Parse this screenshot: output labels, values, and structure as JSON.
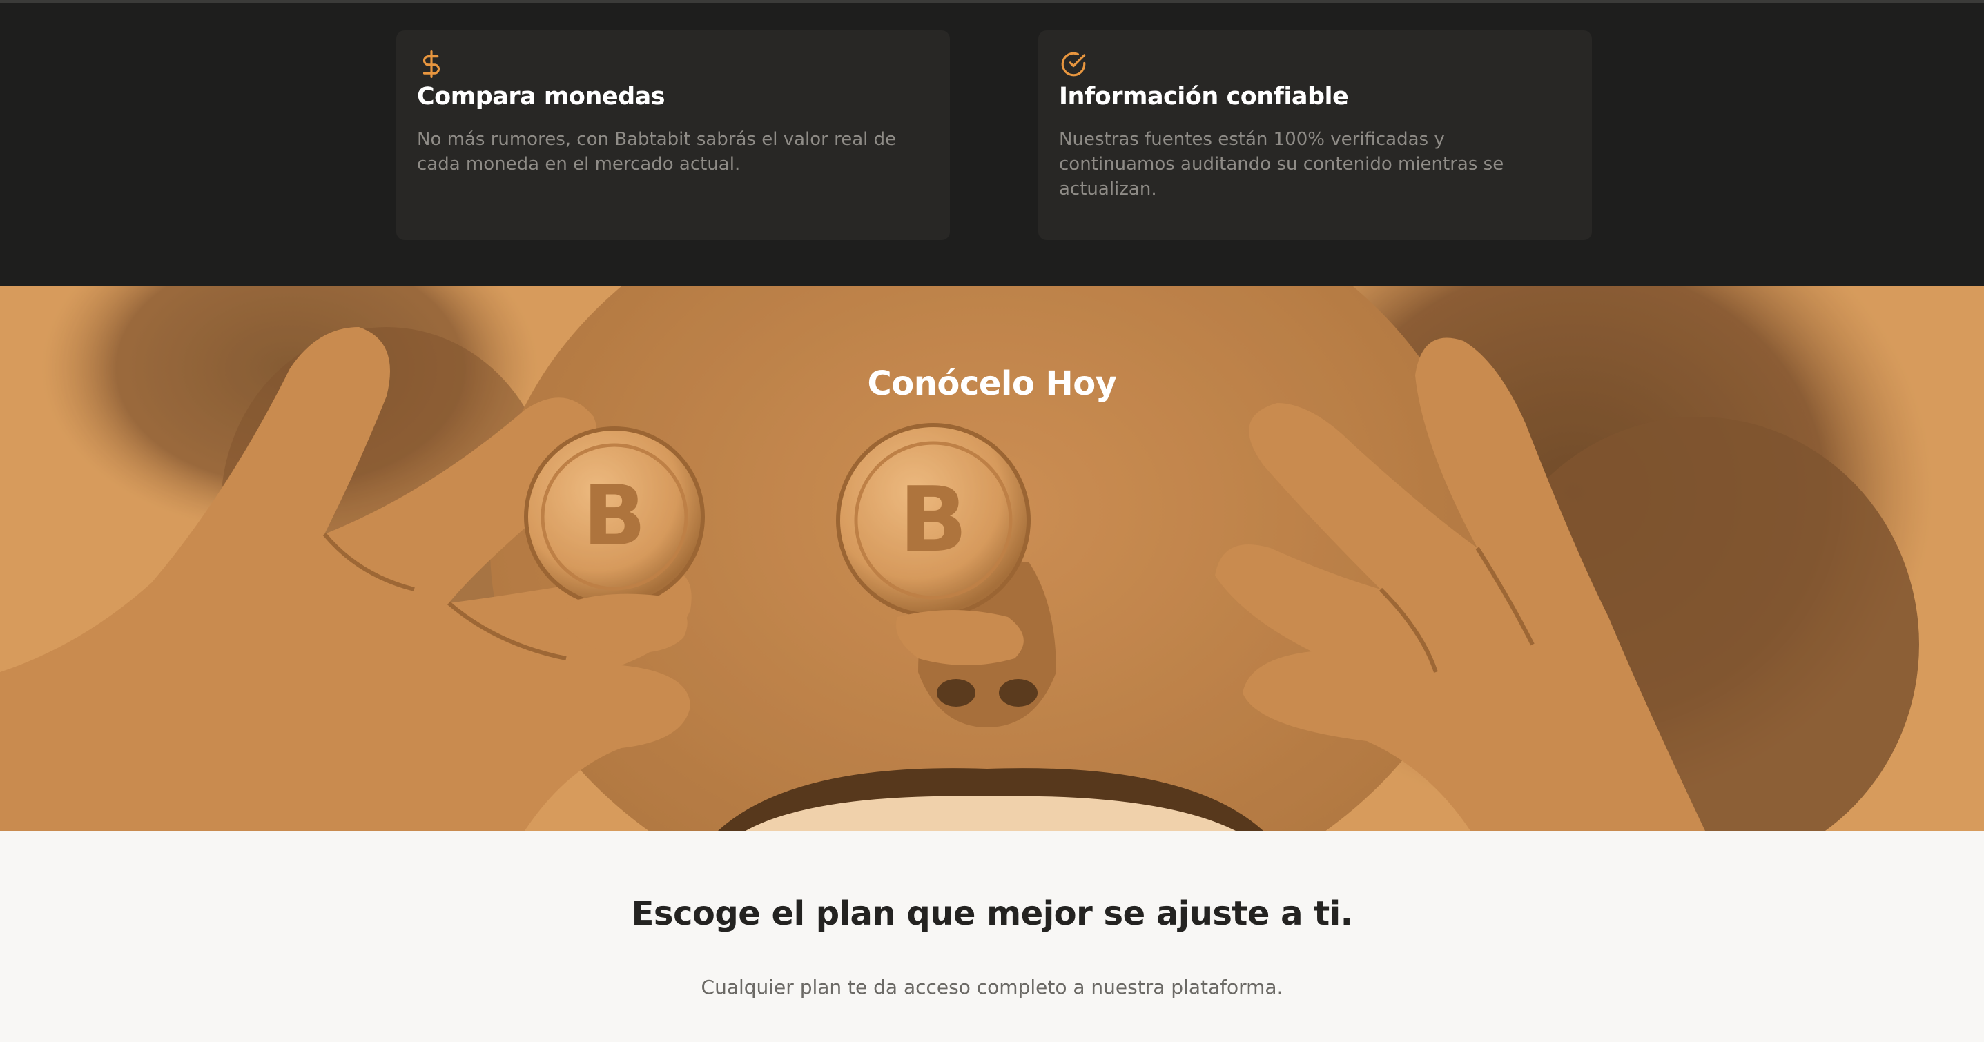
{
  "features": [
    {
      "icon": "dollar-icon",
      "title": "Compara monedas",
      "description": "No más rumores, con Babtabit sabrás el valor real de cada moneda en el mercado actual."
    },
    {
      "icon": "check-circle-icon",
      "title": "Información confiable",
      "description": "Nuestras fuentes están 100% verificadas y continuamos auditando su contenido mientras se actualizan."
    }
  ],
  "hero": {
    "title": "Conócelo Hoy",
    "image": "person-holding-bitcoin-coins-over-eyes"
  },
  "plans": {
    "heading": "Escoge el plan que mejor se ajuste a ti.",
    "subheading": "Cualquier plan te da acceso completo a nuestra plataforma."
  },
  "colors": {
    "accent": "#e8963f",
    "dark_bg": "#1e1e1d",
    "card_bg": "#282725",
    "hero_tint": "#d49a5e",
    "light_bg": "#f8f7f5"
  }
}
